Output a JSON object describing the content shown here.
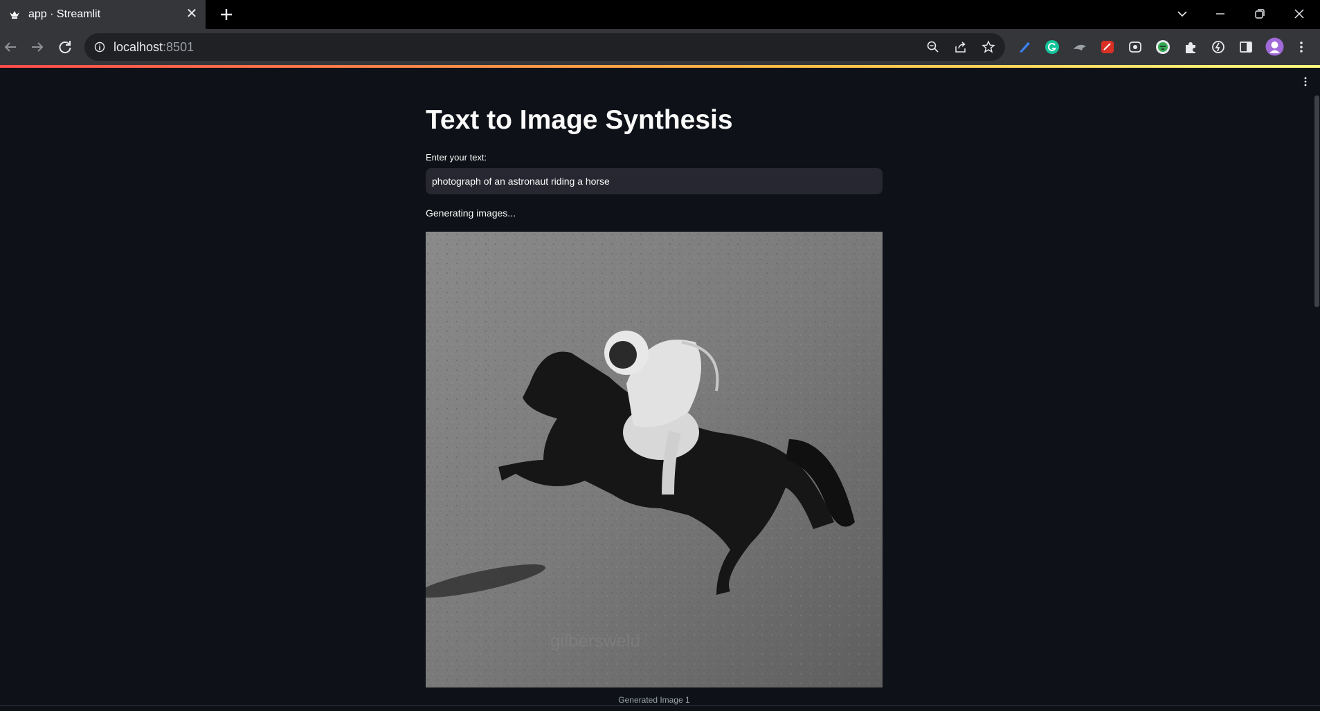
{
  "browser": {
    "tab_title": "app · Streamlit",
    "close_glyph": "✕",
    "address_host": "localhost",
    "address_port": ":8501"
  },
  "extensions": [
    "zoom-icon",
    "share-icon",
    "bookmark-star-icon",
    "pen-extension-icon",
    "grammarly-icon",
    "shark-extension-icon",
    "red-extension-icon",
    "camera-extension-icon",
    "translate-extension-icon",
    "puzzle-extensions-icon",
    "speed-extension-icon",
    "side-panel-icon",
    "profile-avatar"
  ],
  "app": {
    "title": "Text to Image Synthesis",
    "input_label": "Enter your text:",
    "input_value": "photograph of an astronaut riding a horse",
    "status": "Generating images...",
    "image_caption": "Generated Image 1",
    "image_alt": "Generated Image 1"
  },
  "colors": {
    "background": "#0e1117",
    "input_bg": "#262730",
    "text": "#fafafa",
    "accent": "#ff4b4b"
  }
}
